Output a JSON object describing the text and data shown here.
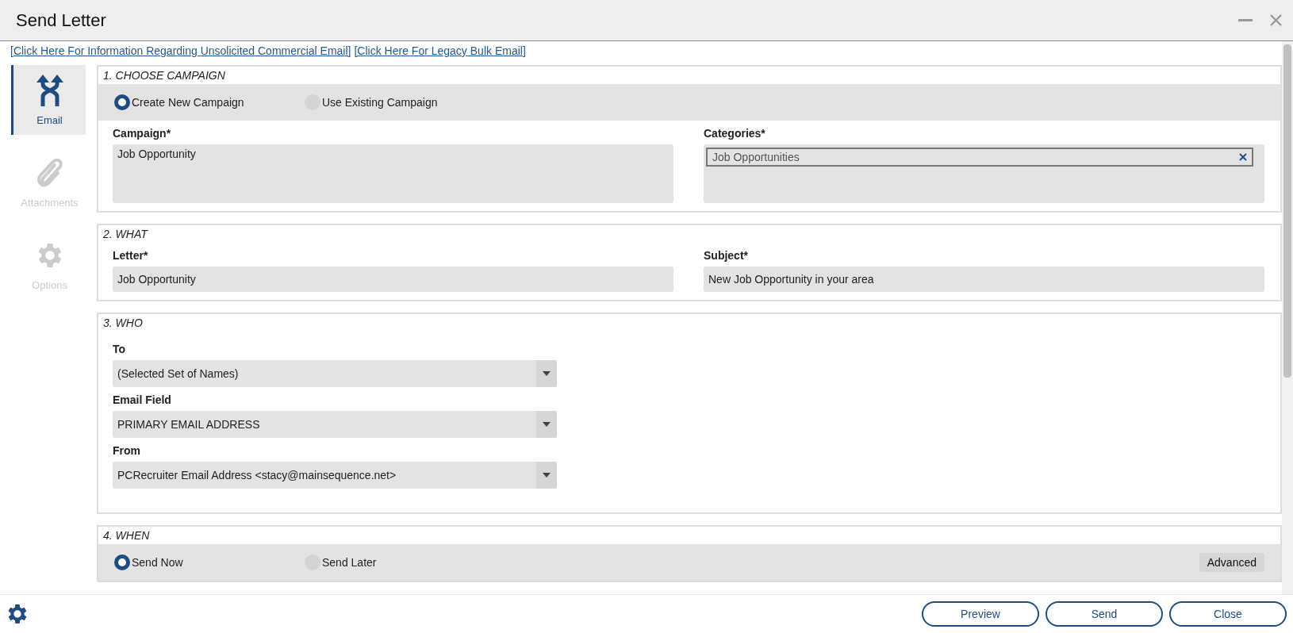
{
  "window": {
    "title": "Send Letter"
  },
  "links": [
    "[Click Here For Information Regarding Unsolicited Commercial Email]",
    "[Click Here For Legacy Bulk Email]"
  ],
  "sidebar": {
    "items": [
      {
        "label": "Email",
        "kind": "merge",
        "selected": true
      },
      {
        "label": "Attachments",
        "kind": "clip",
        "selected": false
      },
      {
        "label": "Options",
        "kind": "gear",
        "selected": false
      }
    ]
  },
  "campaign": {
    "heading": "1. CHOOSE CAMPAIGN",
    "options": [
      {
        "label": "Create New Campaign",
        "selected": true
      },
      {
        "label": "Use Existing Campaign",
        "selected": false
      }
    ],
    "campaign_field": {
      "label": "Campaign*",
      "value": "Job Opportunity"
    },
    "categories": {
      "label": "Categories*",
      "tags": [
        "Job Opportunities"
      ]
    }
  },
  "what": {
    "heading": "2. WHAT",
    "fields": [
      {
        "label": "Letter*",
        "value": "Job Opportunity"
      },
      {
        "label": "Subject*",
        "value": "New Job Opportunity in your area"
      }
    ]
  },
  "who": {
    "heading": "3. WHO",
    "dropdowns": [
      {
        "label": "To",
        "value": "(Selected Set of Names)"
      },
      {
        "label": "Email Field",
        "value": "PRIMARY EMAIL ADDRESS"
      },
      {
        "label": "From",
        "value": "PCRecruiter Email Address <stacy@mainsequence.net>"
      }
    ]
  },
  "when": {
    "heading": "4. WHEN",
    "options": [
      {
        "label": "Send Now",
        "selected": true
      },
      {
        "label": "Send Later",
        "selected": false
      }
    ],
    "advanced_button": "Advanced"
  },
  "footer": {
    "buttons": [
      "Preview",
      "Send",
      "Close"
    ]
  }
}
